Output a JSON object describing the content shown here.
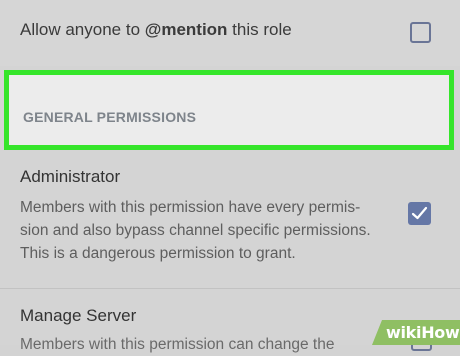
{
  "mention": {
    "label_prefix": "Allow anyone to ",
    "label_bold": "@mention",
    "label_suffix": " this role",
    "checked": false
  },
  "section": {
    "title": "GENERAL PERMISSIONS"
  },
  "permissions": [
    {
      "title": "Administrator",
      "description_lines": [
        "Members with this permission have every permis-",
        "sion and also bypass channel specific permissions.",
        "This is a dangerous permission to grant."
      ],
      "checked": true
    },
    {
      "title": "Manage Server",
      "description_lines": [
        "Members with this permission can change the"
      ],
      "checked": false
    }
  ],
  "watermark": {
    "text": "wikiHow"
  },
  "colors": {
    "background": "#d4d4d4",
    "highlight_border": "#35e52a",
    "checkbox_accent": "#6577a6",
    "section_title": "#7e848b"
  }
}
